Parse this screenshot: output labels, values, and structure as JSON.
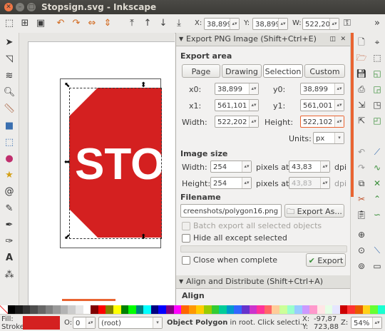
{
  "window": {
    "title": "Stopsign.svg - Inkscape"
  },
  "toolbar": {
    "x_label": "X:",
    "x_value": "38,899",
    "y_label": "Y:",
    "y_value": "38,899",
    "w_label": "W:",
    "w_value": "522,202"
  },
  "canvas": {
    "sign_text": "STO"
  },
  "export_dialog": {
    "title": "Export PNG Image (Shift+Ctrl+E)",
    "export_area_heading": "Export area",
    "area_buttons": [
      "Page",
      "Drawing",
      "Selection",
      "Custom"
    ],
    "active_area": "Selection",
    "x0_label": "x0:",
    "x0_value": "38,899",
    "y0_label": "y0:",
    "y0_value": "38,899",
    "x1_label": "x1:",
    "x1_value": "561,101",
    "y1_label": "y1:",
    "y1_value": "561,001",
    "width_label": "Width:",
    "width_value": "522,202",
    "height_label": "Height:",
    "height_value": "522,102",
    "units_label": "Units:",
    "units_value": "px",
    "image_size_heading": "Image size",
    "img_width_label": "Width:",
    "img_width_value": "254",
    "img_height_label": "Height:",
    "img_height_value": "254",
    "pixels_at_label": "pixels at",
    "dpi_value": "43,83",
    "dpi_value_disabled": "43,83",
    "dpi_label": "dpi",
    "filename_heading": "Filename",
    "filename_value": "creenshots/polygon16.png",
    "export_as_label": "Export As...",
    "batch_label": "Batch export all selected objects",
    "hide_label": "Hide all except selected",
    "close_when_complete_label": "Close when complete",
    "export_button_label": "Export"
  },
  "align_dialog": {
    "title": "Align and Distribute (Shift+Ctrl+A)",
    "section_label": "Align"
  },
  "statusbar": {
    "fill_label": "Fill:",
    "stroke_label": "Stroke:",
    "fill_color": "#d42020",
    "opacity_label": "O:",
    "opacity_value": "0",
    "layer_value": "(root)",
    "message_bold": "Object Polygon",
    "message_rest": " in root. Click selecti...",
    "cursor_x_label": "X:",
    "cursor_x_value": "-97,87",
    "cursor_y_label": "Y:",
    "cursor_y_value": "723,88",
    "zoom_label": "Z:",
    "zoom_value": "54%"
  },
  "palette_colors": [
    "#000000",
    "#1a1a1a",
    "#333333",
    "#4d4d4d",
    "#666666",
    "#808080",
    "#999999",
    "#b3b3b3",
    "#cccccc",
    "#e6e6e6",
    "#ffffff",
    "#800000",
    "#ff0000",
    "#808000",
    "#ffff00",
    "#008000",
    "#00ff00",
    "#008080",
    "#00ffff",
    "#000080",
    "#0000ff",
    "#800080",
    "#ff00ff",
    "#ff6600",
    "#ff9900",
    "#ffcc00",
    "#99cc00",
    "#33cc33",
    "#00cc99",
    "#0099cc",
    "#3366ff",
    "#6633cc",
    "#cc33cc",
    "#ff3399",
    "#ff6666",
    "#ffcc99",
    "#ccff99",
    "#99ffcc",
    "#99ccff",
    "#cc99ff",
    "#ff99cc",
    "#ffe6e6",
    "#e6ffe6",
    "#e6e6ff",
    "#cc0000",
    "#ff3333",
    "#e65c00",
    "#ffd11a",
    "#66ff33",
    "#1affd1"
  ]
}
